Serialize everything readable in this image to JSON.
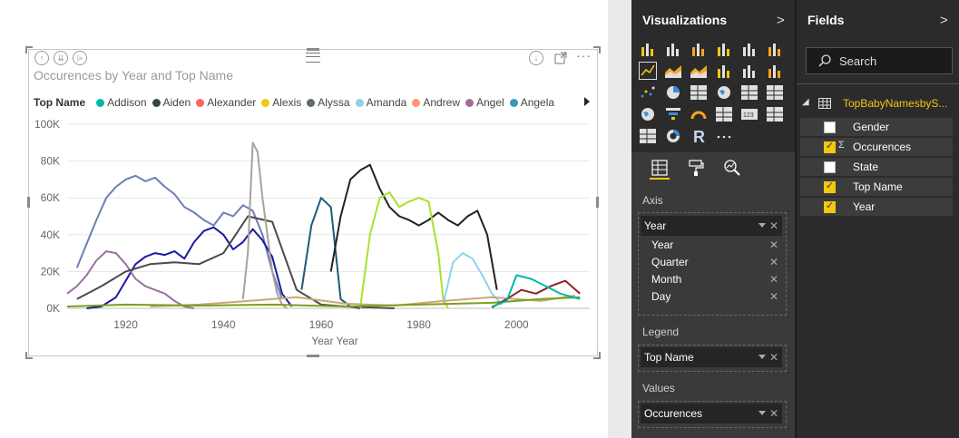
{
  "visual": {
    "title": "Occurences by Year and Top Name",
    "legend_title": "Top Name",
    "legend_items": [
      {
        "name": "Addison",
        "color": "#01b8aa"
      },
      {
        "name": "Aiden",
        "color": "#374649"
      },
      {
        "name": "Alexander",
        "color": "#fd625e"
      },
      {
        "name": "Alexis",
        "color": "#f2c80f"
      },
      {
        "name": "Alyssa",
        "color": "#5f6b6d"
      },
      {
        "name": "Amanda",
        "color": "#8ad4eb"
      },
      {
        "name": "Andrew",
        "color": "#fe9666"
      },
      {
        "name": "Angel",
        "color": "#a66999"
      },
      {
        "name": "Angela",
        "color": "#3599b8"
      }
    ]
  },
  "chart_data": {
    "type": "line",
    "title": "Occurences by Year and Top Name",
    "xlabel": "Year Year",
    "ylabel": "",
    "x_ticks": [
      "1920",
      "1940",
      "1960",
      "1980",
      "2000"
    ],
    "y_ticks": [
      "0K",
      "20K",
      "40K",
      "60K",
      "80K",
      "100K"
    ],
    "xlim": [
      1908,
      2015
    ],
    "ylim": [
      0,
      100000
    ],
    "grid": true,
    "legend_position": "top",
    "series": [
      {
        "color": "#6c7fb0",
        "x": [
          1910,
          1912,
          1914,
          1916,
          1918,
          1920,
          1922,
          1924,
          1926,
          1928,
          1930,
          1932,
          1934,
          1936,
          1938,
          1940,
          1942,
          1944,
          1946,
          1948,
          1950,
          1952
        ],
        "values": [
          22000,
          35000,
          48000,
          60000,
          66000,
          70000,
          72000,
          69000,
          71000,
          66000,
          62000,
          55000,
          52000,
          48000,
          45000,
          52000,
          50000,
          56000,
          53000,
          40000,
          20000,
          5000
        ]
      },
      {
        "color": "#1a1aa0",
        "x": [
          1912,
          1915,
          1918,
          1920,
          1922,
          1924,
          1926,
          1928,
          1930,
          1932,
          1934,
          1936,
          1938,
          1940,
          1942,
          1944,
          1946,
          1948,
          1950,
          1952,
          1954
        ],
        "values": [
          0,
          1000,
          6000,
          15000,
          24000,
          28000,
          30000,
          29000,
          31000,
          27000,
          36000,
          42000,
          44000,
          40000,
          32000,
          36000,
          43000,
          37000,
          28000,
          8000,
          1000
        ]
      },
      {
        "color": "#9b6fa0",
        "x": [
          1908,
          1910,
          1912,
          1914,
          1916,
          1918,
          1920,
          1922,
          1924,
          1926,
          1928,
          1930,
          1932,
          1934
        ],
        "values": [
          8000,
          12000,
          18000,
          26000,
          31000,
          30000,
          24000,
          16000,
          12000,
          10000,
          8000,
          4000,
          1000,
          0
        ]
      },
      {
        "color": "#4a4a4a",
        "x": [
          1910,
          1915,
          1920,
          1925,
          1930,
          1935,
          1940,
          1945,
          1950,
          1955,
          1960,
          1965,
          1970,
          1975
        ],
        "values": [
          5000,
          12000,
          20000,
          24000,
          25000,
          24000,
          30000,
          50000,
          47000,
          10000,
          2000,
          1000,
          500,
          0
        ]
      },
      {
        "color": "#a8a29a",
        "x": [
          1944,
          1945,
          1946,
          1947,
          1948,
          1949,
          1950,
          1951,
          1952,
          1953
        ],
        "values": [
          5000,
          30000,
          90000,
          85000,
          60000,
          40000,
          20000,
          8000,
          2000,
          0
        ]
      },
      {
        "color": "#1e5a78",
        "x": [
          1956,
          1958,
          1960,
          1962,
          1963,
          1964,
          1966,
          1968
        ],
        "values": [
          10000,
          45000,
          60000,
          55000,
          30000,
          5000,
          1000,
          0
        ]
      },
      {
        "color": "#222222",
        "x": [
          1962,
          1964,
          1966,
          1968,
          1970,
          1972,
          1974,
          1976,
          1978,
          1980,
          1982,
          1984,
          1986,
          1988,
          1990,
          1992,
          1994,
          1996
        ],
        "values": [
          20000,
          50000,
          70000,
          75000,
          78000,
          65000,
          55000,
          50000,
          48000,
          45000,
          48000,
          52000,
          48000,
          45000,
          50000,
          53000,
          40000,
          10000
        ]
      },
      {
        "color": "#a6e22e",
        "x": [
          1968,
          1970,
          1972,
          1974,
          1976,
          1978,
          1980,
          1982,
          1984,
          1985,
          1986
        ],
        "values": [
          0,
          40000,
          60000,
          63000,
          55000,
          58000,
          60000,
          58000,
          30000,
          5000,
          0
        ]
      },
      {
        "color": "#8ad4eb",
        "x": [
          1985,
          1987,
          1989,
          1991,
          1993,
          1995,
          1997
        ],
        "values": [
          2000,
          25000,
          30000,
          27000,
          18000,
          8000,
          2000
        ]
      },
      {
        "color": "#c8a878",
        "x": [
          1925,
          1935,
          1945,
          1955,
          1965,
          1975,
          1985,
          1995,
          2005,
          2012
        ],
        "values": [
          1000,
          2000,
          4000,
          6000,
          2500,
          1500,
          4000,
          6000,
          4000,
          7000
        ]
      },
      {
        "color": "#7aa01e",
        "x": [
          1908,
          1920,
          1935,
          1950,
          1965,
          1980,
          1995,
          2005,
          2013
        ],
        "values": [
          1000,
          2000,
          1500,
          2000,
          1000,
          2000,
          3000,
          5000,
          6000
        ]
      },
      {
        "color": "#8f2020",
        "x": [
          1995,
          1998,
          2001,
          2004,
          2007,
          2010,
          2013
        ],
        "values": [
          500,
          5000,
          10000,
          8000,
          12000,
          15000,
          8000
        ]
      },
      {
        "color": "#01b8aa",
        "x": [
          1995,
          1998,
          2000,
          2003,
          2006,
          2009,
          2013
        ],
        "values": [
          1000,
          4000,
          18000,
          16000,
          12000,
          8000,
          5000
        ]
      }
    ]
  },
  "visualizations": {
    "title": "Visualizations",
    "axis_label": "Axis",
    "legend_label": "Legend",
    "values_label": "Values",
    "axis_field": "Year",
    "axis_hierarchy": [
      "Year",
      "Quarter",
      "Month",
      "Day"
    ],
    "legend_field": "Top Name",
    "values_field": "Occurences",
    "more_label": "···"
  },
  "fields": {
    "title": "Fields",
    "search_placeholder": "Search",
    "table_name": "TopBabyNamesbyS...",
    "items": [
      {
        "name": "Gender",
        "checked": false,
        "sigma": false
      },
      {
        "name": "Occurences",
        "checked": true,
        "sigma": true
      },
      {
        "name": "State",
        "checked": false,
        "sigma": false
      },
      {
        "name": "Top Name",
        "checked": true,
        "sigma": false
      },
      {
        "name": "Year",
        "checked": true,
        "sigma": false
      }
    ]
  }
}
